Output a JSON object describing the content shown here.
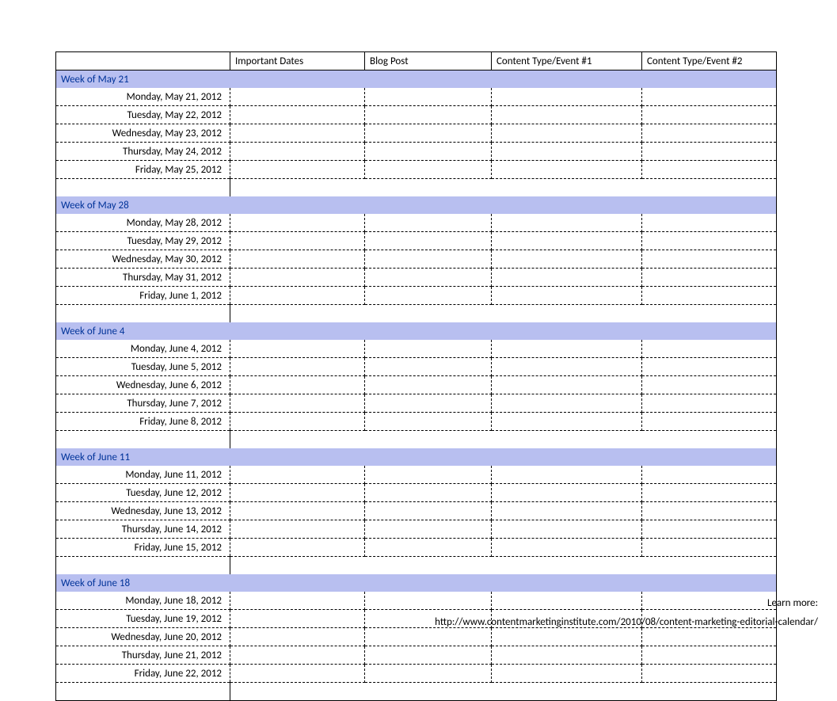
{
  "columns": [
    "",
    "Important Dates",
    "Blog Post",
    "Content Type/Event #1",
    "Content Type/Event #2"
  ],
  "weeks": [
    {
      "label": "Week of May 21",
      "days": [
        "Monday, May 21, 2012",
        "Tuesday, May 22, 2012",
        "Wednesday, May 23, 2012",
        "Thursday, May 24, 2012",
        "Friday, May 25, 2012"
      ]
    },
    {
      "label": "Week of May 28",
      "days": [
        "Monday, May 28, 2012",
        "Tuesday, May 29, 2012",
        "Wednesday, May 30, 2012",
        "Thursday, May 31, 2012",
        "Friday, June 1, 2012"
      ]
    },
    {
      "label": "Week of June 4",
      "days": [
        "Monday, June 4, 2012",
        "Tuesday, June 5, 2012",
        "Wednesday, June 6, 2012",
        "Thursday, June 7, 2012",
        "Friday, June 8, 2012"
      ]
    },
    {
      "label": "Week of June 11",
      "days": [
        "Monday, June 11, 2012",
        "Tuesday, June 12, 2012",
        "Wednesday, June 13, 2012",
        "Thursday, June 14, 2012",
        "Friday, June 15, 2012"
      ]
    },
    {
      "label": "Week of June 18",
      "days": [
        "Monday, June 18, 2012",
        "Tuesday, June 19, 2012",
        "Wednesday, June 20, 2012",
        "Thursday, June 21, 2012",
        "Friday, June 22, 2012"
      ]
    }
  ],
  "footer": {
    "learn_more": "Learn more:",
    "url": "http://www.contentmarketinginstitute.com/2010/08/content-marketing-editorial-calendar/"
  }
}
